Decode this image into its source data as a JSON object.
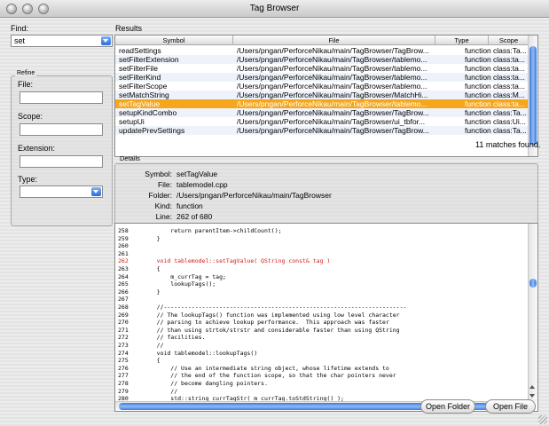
{
  "window": {
    "title": "Tag Browser"
  },
  "find": {
    "label": "Find:",
    "value": "set"
  },
  "refine": {
    "title": "Refine",
    "file_label": "File:",
    "scope_label": "Scope:",
    "extension_label": "Extension:",
    "type_label": "Type:"
  },
  "results": {
    "label": "Results",
    "columns": [
      "Symbol",
      "File",
      "Type",
      "Scope"
    ],
    "rows": [
      {
        "symbol": "readSettings",
        "file": "/Users/pngan/PerforceNikau/main/TagBrowser/TagBrow...",
        "type": "function",
        "scope": "class:Ta..."
      },
      {
        "symbol": "setFilterExtension",
        "file": "/Users/pngan/PerforceNikau/main/TagBrowser/tablemo...",
        "type": "function",
        "scope": "class:ta..."
      },
      {
        "symbol": "setFilterFile",
        "file": "/Users/pngan/PerforceNikau/main/TagBrowser/tablemo...",
        "type": "function",
        "scope": "class:ta..."
      },
      {
        "symbol": "setFilterKind",
        "file": "/Users/pngan/PerforceNikau/main/TagBrowser/tablemo...",
        "type": "function",
        "scope": "class:ta..."
      },
      {
        "symbol": "setFilterScope",
        "file": "/Users/pngan/PerforceNikau/main/TagBrowser/tablemo...",
        "type": "function",
        "scope": "class:ta..."
      },
      {
        "symbol": "setMatchString",
        "file": "/Users/pngan/PerforceNikau/main/TagBrowser/MatchHi...",
        "type": "function",
        "scope": "class:M..."
      },
      {
        "symbol": "setTagValue",
        "file": "/Users/pngan/PerforceNikau/main/TagBrowser/tablemo...",
        "type": "function",
        "scope": "class:ta...",
        "selected": true
      },
      {
        "symbol": "setupKindCombo",
        "file": "/Users/pngan/PerforceNikau/main/TagBrowser/TagBrow...",
        "type": "function",
        "scope": "class:Ta..."
      },
      {
        "symbol": "setupUi",
        "file": "/Users/pngan/PerforceNikau/main/TagBrowser/ui_tbfor...",
        "type": "function",
        "scope": "class:Ui..."
      },
      {
        "symbol": "updatePrevSettings",
        "file": "/Users/pngan/PerforceNikau/main/TagBrowser/TagBrow...",
        "type": "function",
        "scope": "class:Ta..."
      }
    ],
    "match_count": "11 matches found."
  },
  "details": {
    "title": "Details",
    "symbol_label": "Symbol:",
    "symbol": "setTagValue",
    "file_label": "File:",
    "file": "tablemodel.cpp",
    "folder_label": "Folder:",
    "folder": "/Users/pngan/PerforceNikau/main/TagBrowser",
    "kind_label": "Kind:",
    "kind": "function",
    "line_label": "Line:",
    "line": "262 of 680"
  },
  "code": {
    "lines": [
      {
        "n": "258",
        "t": "        return parentItem->childCount();"
      },
      {
        "n": "259",
        "t": "    }"
      },
      {
        "n": "260",
        "t": ""
      },
      {
        "n": "261",
        "t": ""
      },
      {
        "n": "262",
        "t": "    void tablemodel::setTagValue( QString const& tag )",
        "hl": true
      },
      {
        "n": "263",
        "t": "    {"
      },
      {
        "n": "264",
        "t": "        m_currTag = tag;"
      },
      {
        "n": "265",
        "t": "        lookupTags();"
      },
      {
        "n": "266",
        "t": "    }"
      },
      {
        "n": "267",
        "t": ""
      },
      {
        "n": "268",
        "t": "    //----------------------------------------------------------------------"
      },
      {
        "n": "269",
        "t": "    // The lookupTags() function was implemented using low level character"
      },
      {
        "n": "270",
        "t": "    // parsing to achieve lookup performance.  This approach was faster"
      },
      {
        "n": "271",
        "t": "    // than using strtok/strstr and considerable faster than using QString"
      },
      {
        "n": "272",
        "t": "    // facilities."
      },
      {
        "n": "273",
        "t": "    //"
      },
      {
        "n": "274",
        "t": "    void tablemodel::lookupTags()"
      },
      {
        "n": "275",
        "t": "    {"
      },
      {
        "n": "276",
        "t": "        // Use an intermediate string object, whose lifetime extends to"
      },
      {
        "n": "277",
        "t": "        // the end of the function scope, so that the char pointers never"
      },
      {
        "n": "278",
        "t": "        // become dangling pointers."
      },
      {
        "n": "279",
        "t": "        //"
      },
      {
        "n": "280",
        "t": "        std::string currTagStr( m_currTag.toStdString() );"
      }
    ]
  },
  "buttons": {
    "open_folder": "Open Folder",
    "open_file": "Open File"
  }
}
